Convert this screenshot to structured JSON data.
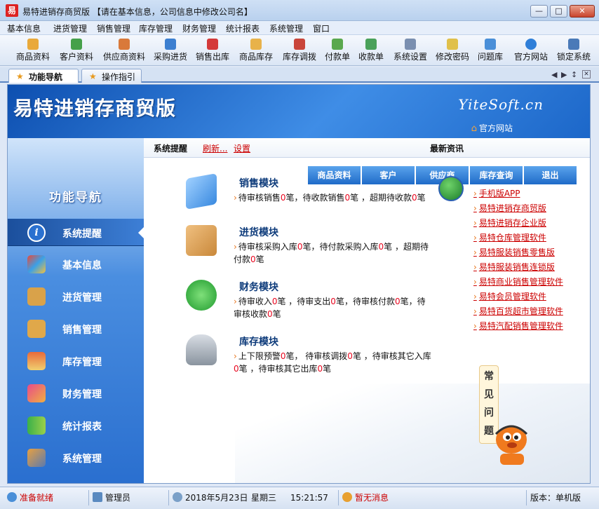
{
  "window": {
    "title": "易特进销存商贸版  【请在基本信息，公司信息中修改公司名】",
    "app_icon": "易"
  },
  "menubar": {
    "items": [
      "基本信息",
      "进货管理",
      "销售管理",
      "库存管理",
      "财务管理",
      "统计报表",
      "系统管理",
      "窗口"
    ]
  },
  "toolbar": {
    "buttons": [
      {
        "label": "商品资料",
        "icon": "goods-icon"
      },
      {
        "label": "客户资料",
        "icon": "customer-icon"
      },
      {
        "label": "供应商资料",
        "icon": "supplier-icon"
      },
      {
        "label": "采购进货",
        "icon": "purchase-icon"
      },
      {
        "label": "销售出库",
        "icon": "sales-out-icon"
      },
      {
        "label": "商品库存",
        "icon": "stock-icon"
      },
      {
        "label": "库存调拨",
        "icon": "transfer-icon"
      },
      {
        "label": "付款单",
        "icon": "payment-icon"
      },
      {
        "label": "收款单",
        "icon": "receipt-icon"
      },
      {
        "label": "系统设置",
        "icon": "settings-icon"
      },
      {
        "label": "修改密码",
        "icon": "password-icon"
      },
      {
        "label": "问题库",
        "icon": "faq-icon"
      },
      {
        "label": "官方网站",
        "icon": "ie-icon"
      },
      {
        "label": "锁定系统",
        "icon": "lock-icon"
      }
    ]
  },
  "tabs": [
    {
      "label": "功能导航",
      "active": true
    },
    {
      "label": "操作指引",
      "active": false
    }
  ],
  "banner": {
    "title": "易特进销存商贸版",
    "site": "YiteSoft.cn",
    "official_link": "官方网站"
  },
  "sidebar": {
    "title": "功能导航",
    "items": [
      {
        "label": "系统提醒",
        "icon": "info-icon",
        "active": true
      },
      {
        "label": "基本信息",
        "icon": "blocks-icon"
      },
      {
        "label": "进货管理",
        "icon": "purchase-box-icon"
      },
      {
        "label": "销售管理",
        "icon": "sales-box-icon"
      },
      {
        "label": "库存管理",
        "icon": "warehouse-icon"
      },
      {
        "label": "财务管理",
        "icon": "finance-icon"
      },
      {
        "label": "统计报表",
        "icon": "chart-icon"
      },
      {
        "label": "系统管理",
        "icon": "tools-icon"
      }
    ]
  },
  "reminder": {
    "title": "系统提醒",
    "refresh": "刷新...",
    "settings": "设置",
    "news_title": "最新资讯"
  },
  "quick_tabs": [
    "商品资料",
    "客户",
    "供应商",
    "库存查询",
    "退出"
  ],
  "modules": [
    {
      "title": "销售模块",
      "desc": "待审核销售0笔，待收款销售0笔 ，超期待收款0笔"
    },
    {
      "title": "进货模块",
      "desc": "待审核采购入库0笔，待付款采购入库0笔 ，超期待付款0笔"
    },
    {
      "title": "财务模块",
      "desc": "待审收入0笔 ，待审支出0笔，待审核付款0笔，待审核收款0笔"
    },
    {
      "title": "库存模块",
      "desc": "上下限预警0笔，  待审核调拨0笔 ，待审核其它入库0笔 ，待审核其它出库0笔"
    }
  ],
  "news": [
    "手机版APP",
    "易特进销存商贸版",
    "易特进销存企业版",
    "易特仓库管理软件",
    "易特服装销售零售版",
    "易特服装销售连锁版",
    "易特商业销售管理软件",
    "易特会员管理软件",
    "易特百货超市管理软件",
    "易特汽配销售管理软件"
  ],
  "faq": "常见问题",
  "statusbar": {
    "status": "准备就绪",
    "user": "管理员",
    "date": "2018年5月23日",
    "weekday": "星期三",
    "time": "15:21:57",
    "messages": "暂无消息",
    "version": "版本：单机版"
  },
  "colors": {
    "accent": "#1f6bc8",
    "link_red": "#cc0000",
    "number_red": "#e8061e"
  }
}
